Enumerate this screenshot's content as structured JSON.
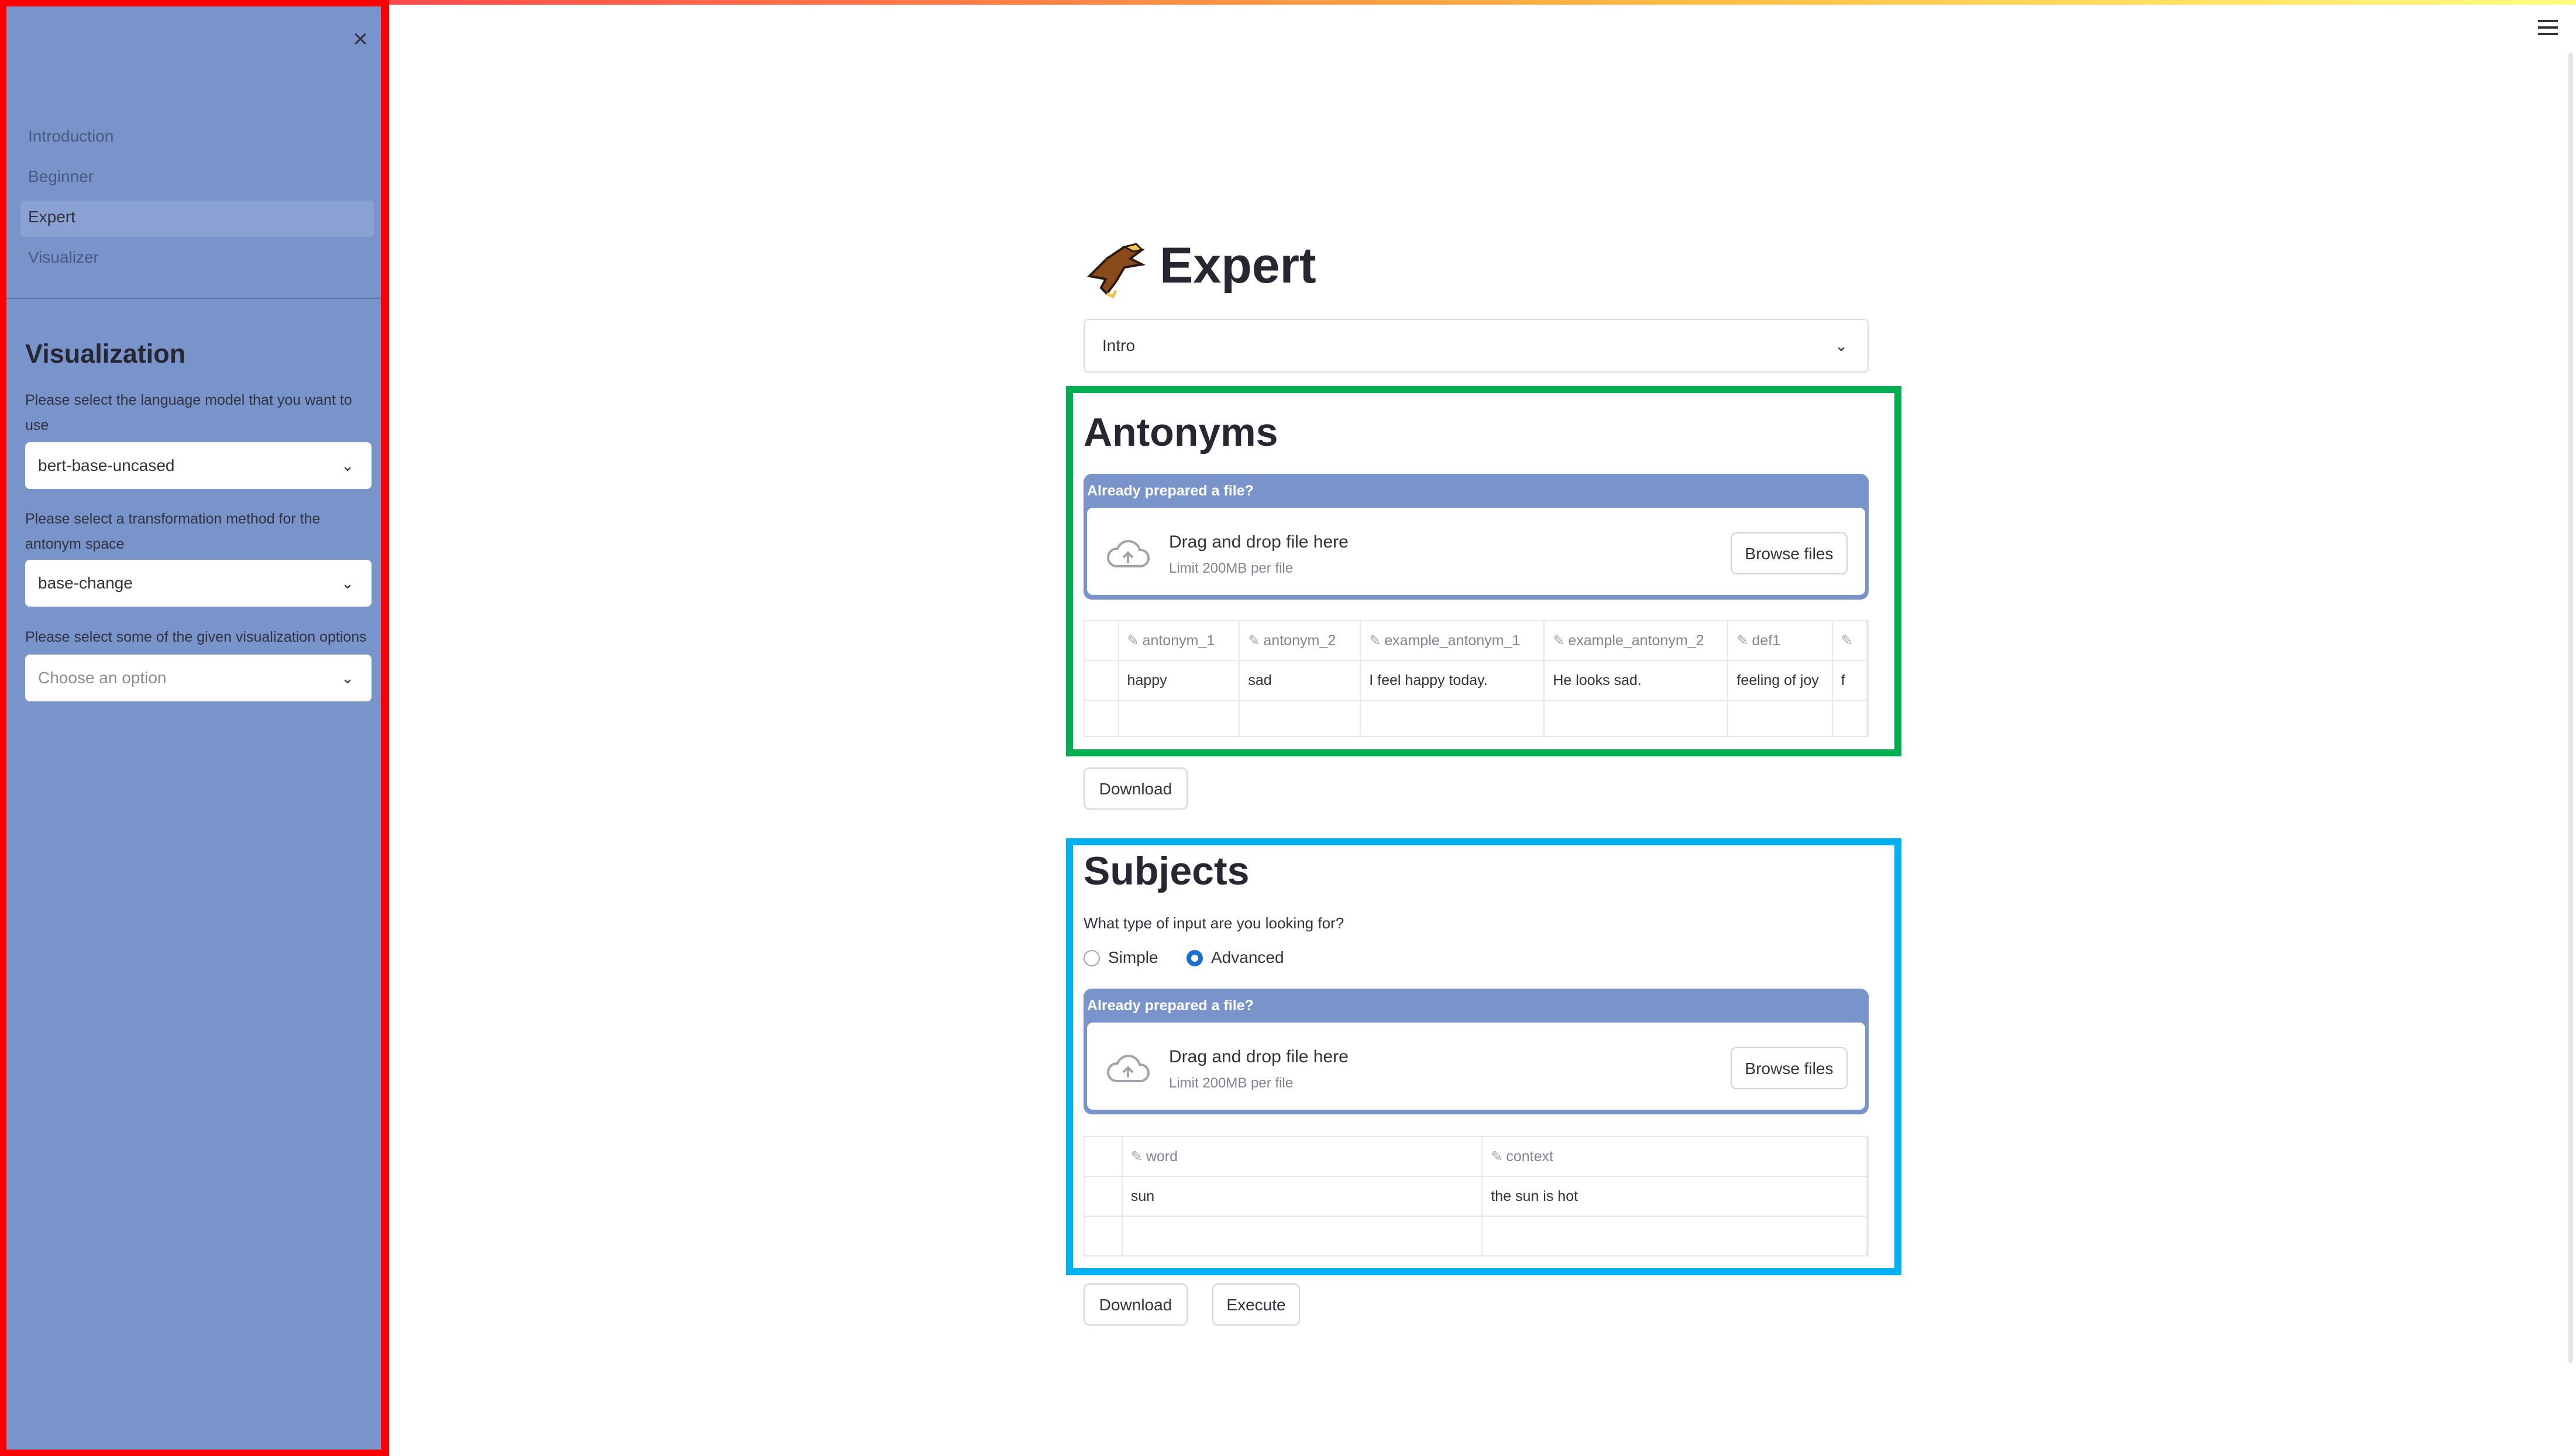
{
  "sidebar": {
    "nav": [
      "Introduction",
      "Beginner",
      "Expert",
      "Visualizer"
    ],
    "heading": "Visualization",
    "label_model": "Please select the language model that you want to use",
    "model_value": "bert-base-uncased",
    "label_transform": "Please select a transformation method for the antonym space",
    "transform_value": "base-change",
    "label_options": "Please select some of the given visualization options",
    "options_placeholder": "Choose an option"
  },
  "page": {
    "title": "Expert",
    "section_select": "Intro"
  },
  "antonyms": {
    "heading": "Antonyms",
    "uploader": {
      "header": "Already prepared a file?",
      "drag": "Drag and drop file here",
      "limit": "Limit 200MB per file",
      "browse": "Browse files"
    },
    "columns": [
      "antonym_1",
      "antonym_2",
      "example_antonym_1",
      "example_antonym_2",
      "def1"
    ],
    "rows": [
      [
        "happy",
        "sad",
        "I feel happy today.",
        "He looks sad.",
        "feeling of joy"
      ]
    ],
    "download": "Download"
  },
  "subjects": {
    "heading": "Subjects",
    "question": "What type of input are you looking for?",
    "radio": [
      "Simple",
      "Advanced"
    ],
    "radio_selected": "Advanced",
    "uploader": {
      "header": "Already prepared a file?",
      "drag": "Drag and drop file here",
      "limit": "Limit 200MB per file",
      "browse": "Browse files"
    },
    "columns": [
      "word",
      "context"
    ],
    "rows": [
      [
        "sun",
        "the sun is hot"
      ]
    ],
    "download": "Download",
    "execute": "Execute"
  },
  "colors": {
    "sidebar_bg": "#7894cb",
    "highlight_red": "#ff0000",
    "highlight_green": "#00b050",
    "highlight_blue": "#00b0f0",
    "accent": "#1c6fd1"
  }
}
